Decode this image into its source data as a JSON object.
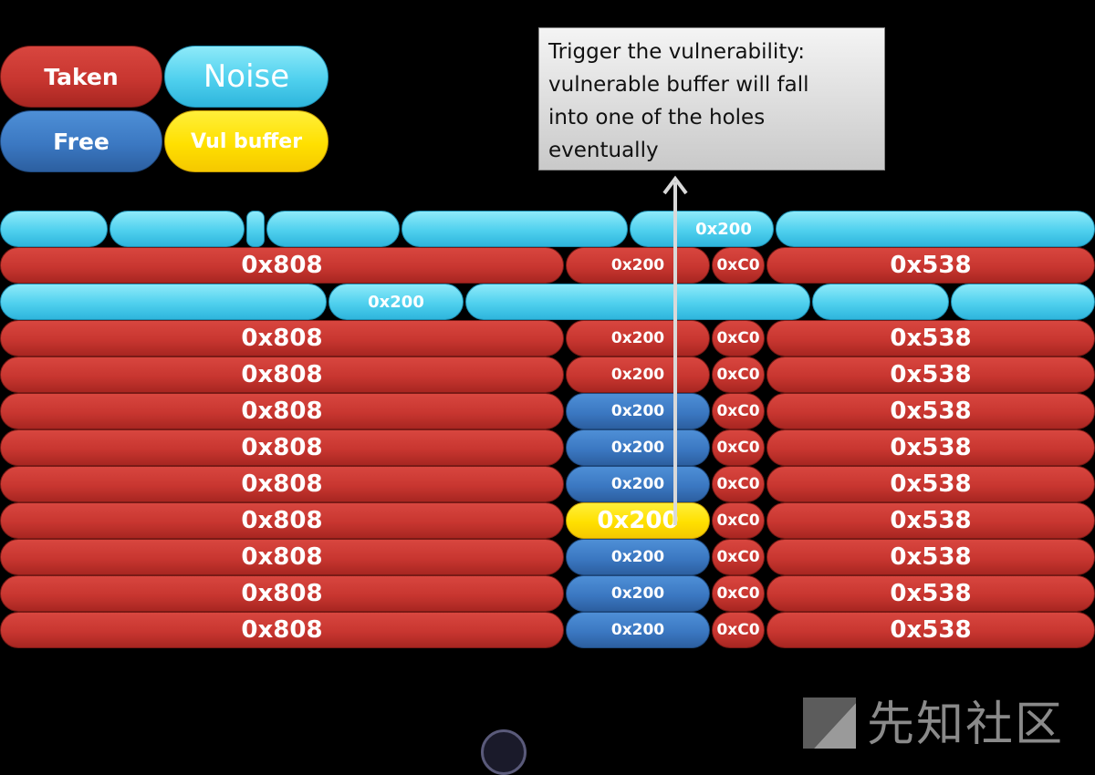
{
  "legend": {
    "taken": "Taken",
    "noise": "Noise",
    "free": "Free",
    "vul": "Vul buffer"
  },
  "callout": {
    "text_line1": "Trigger the vulnerability:",
    "text_line2": "vulnerable buffer will fall",
    "text_line3": "into one of the holes",
    "text_line4": "eventually"
  },
  "noise_rows": [
    {
      "label": "0x200"
    },
    {
      "label": "0x200"
    }
  ],
  "heap_rows": [
    {
      "a": "0x808",
      "b": "0x200",
      "c": "0xC0",
      "d": "0x538",
      "b_state": "taken"
    },
    {
      "a": "0x808",
      "b": "0x200",
      "c": "0xC0",
      "d": "0x538",
      "b_state": "taken"
    },
    {
      "a": "0x808",
      "b": "0x200",
      "c": "0xC0",
      "d": "0x538",
      "b_state": "taken"
    },
    {
      "a": "0x808",
      "b": "0x200",
      "c": "0xC0",
      "d": "0x538",
      "b_state": "free"
    },
    {
      "a": "0x808",
      "b": "0x200",
      "c": "0xC0",
      "d": "0x538",
      "b_state": "free"
    },
    {
      "a": "0x808",
      "b": "0x200",
      "c": "0xC0",
      "d": "0x538",
      "b_state": "free"
    },
    {
      "a": "0x808",
      "b": "0x200",
      "c": "0xC0",
      "d": "0x538",
      "b_state": "vul"
    },
    {
      "a": "0x808",
      "b": "0x200",
      "c": "0xC0",
      "d": "0x538",
      "b_state": "free"
    },
    {
      "a": "0x808",
      "b": "0x200",
      "c": "0xC0",
      "d": "0x538",
      "b_state": "free"
    },
    {
      "a": "0x808",
      "b": "0x200",
      "c": "0xC0",
      "d": "0x538",
      "b_state": "free"
    }
  ],
  "watermark": "先知社区",
  "colors": {
    "taken": "#c83630",
    "free": "#3b78c2",
    "noise": "#4fd0ee",
    "vul": "#ffe000",
    "background": "#000000"
  }
}
